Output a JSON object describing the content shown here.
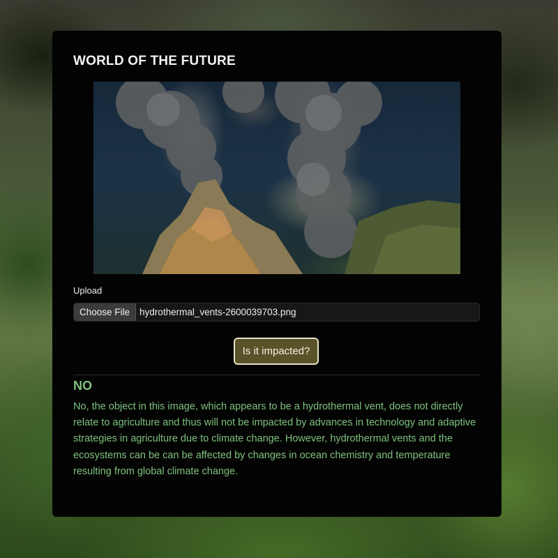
{
  "app": {
    "title": "WORLD OF THE FUTURE"
  },
  "image": {
    "alt": "hydrothermal vents"
  },
  "upload": {
    "label": "Upload",
    "button_label": "Choose File",
    "file_name": "hydrothermal_vents-2600039703.png"
  },
  "submit": {
    "label": "Is it impacted?"
  },
  "result": {
    "heading": "NO",
    "text": "No, the object in this image, which appears to be a hydrothermal vent, does not directly relate to agriculture and thus will not be impacted by advances in technology and adaptive strategies in agriculture due to climate change. However, hydrothermal vents and the ecosystems can be can be affected by changes in ocean chemistry and temperature resulting from global climate change."
  },
  "colors": {
    "panel": "#030303",
    "result_text": "#7ec27e",
    "button_bg": "#5a5228",
    "button_border": "#e6e2c4"
  }
}
